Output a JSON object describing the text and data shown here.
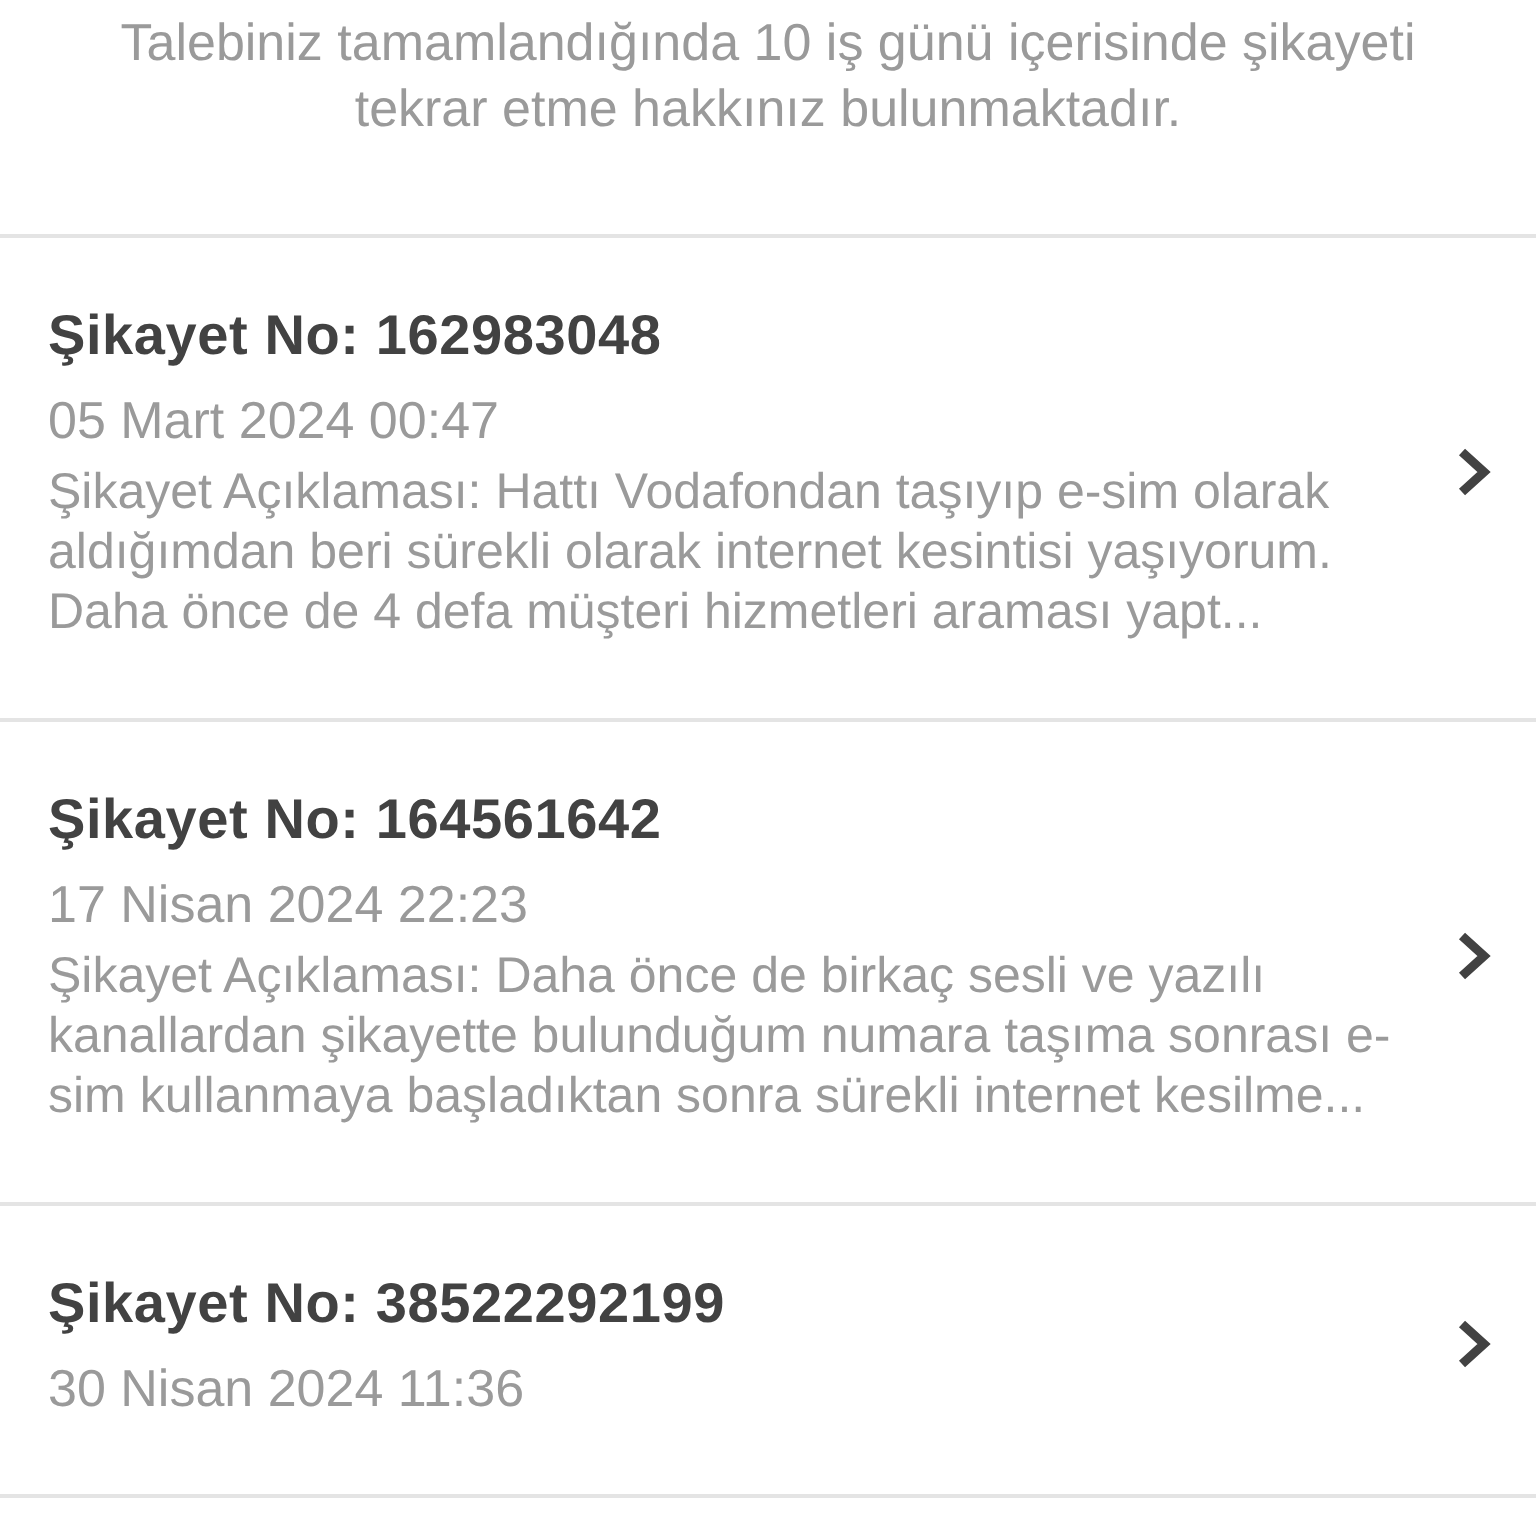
{
  "intro": "Talebiniz tamamlandığında 10 iş günü içerisinde şikayeti tekrar etme hakkınız bulunmaktadır.",
  "complaints": [
    {
      "title": "Şikayet No: 162983048",
      "date": "05 Mart 2024 00:47",
      "description": "Şikayet Açıklaması: Hattı Vodafondan taşıyıp e-sim olarak aldığımdan beri sürekli olarak internet kesintisi yaşıyorum. Daha önce de 4 defa müşteri hizmetleri araması yapt..."
    },
    {
      "title": "Şikayet No: 164561642",
      "date": "17 Nisan 2024 22:23",
      "description": "Şikayet Açıklaması: Daha önce de birkaç sesli ve yazılı kanallardan şikayette bulunduğum numara taşıma sonrası e-sim kullanmaya başladıktan sonra sürekli internet kesilme..."
    },
    {
      "title": "Şikayet No: 38522292199",
      "date": "30 Nisan 2024 11:36"
    }
  ]
}
